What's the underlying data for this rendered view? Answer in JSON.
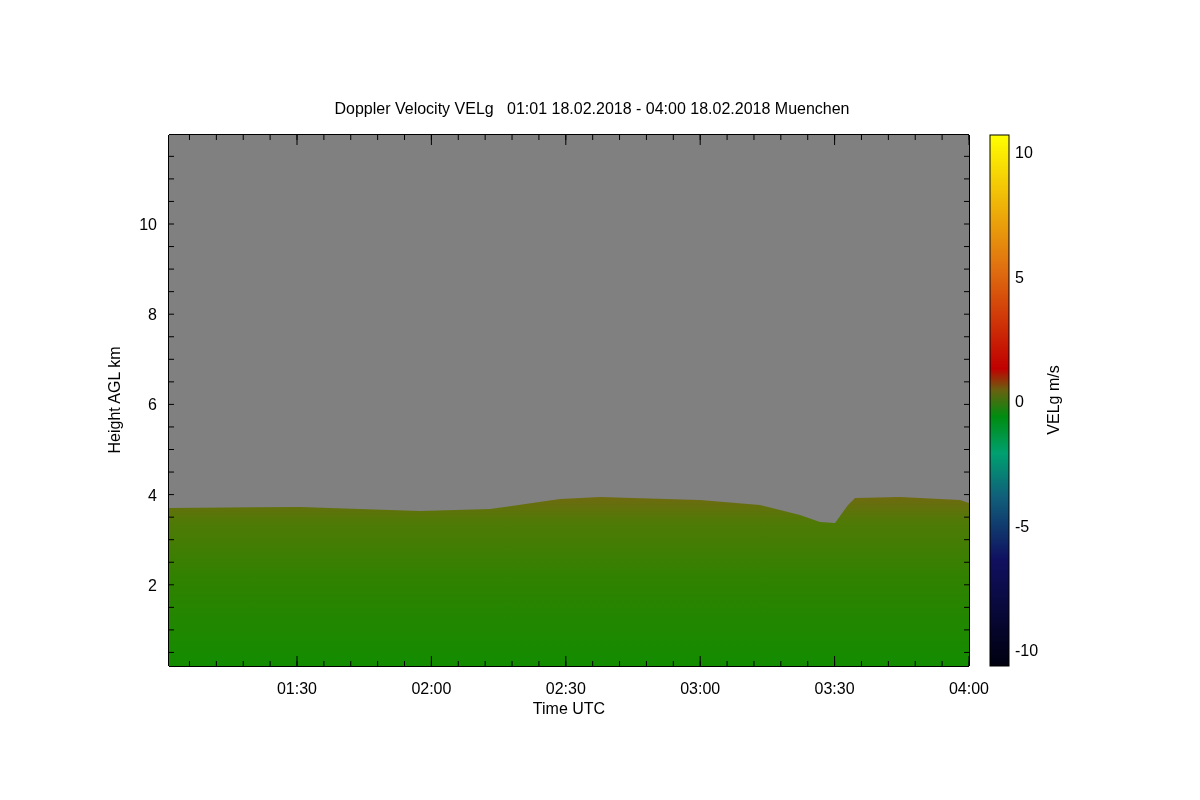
{
  "title": "Doppler Velocity VELg   01:01 18.02.2018 - 04:00 18.02.2018 Muenchen",
  "x_axis": {
    "label": "Time UTC",
    "ticks": [
      "01:30",
      "02:00",
      "02:30",
      "03:00",
      "03:30",
      "04:00"
    ]
  },
  "y_axis": {
    "label": "Height AGL km",
    "ticks": [
      "10",
      "8",
      "6",
      "4",
      "2"
    ]
  },
  "colorbar": {
    "label": "VELg m/s",
    "ticks": [
      "10",
      "5",
      "0",
      "-5",
      "-10"
    ]
  }
}
